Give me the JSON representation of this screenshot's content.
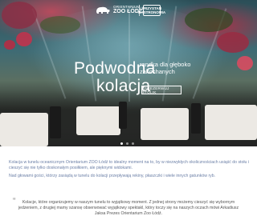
{
  "header": {
    "logo_zoo_line1": "ORIENTARIUM",
    "logo_zoo_line2": "ZOO ŁÓDŹ",
    "logo_badge_line1": "PRZYSTAN",
    "logo_badge_line2": "GASTRONOMIA"
  },
  "hero": {
    "title_part1": "Podwodna",
    "title_part2": "kolacja",
    "subtitle_line1": "randka dla głęboko",
    "subtitle_line2": "zakochanych",
    "reserve_button": "ZAREZERWUJ STOLIK",
    "slides": 3,
    "active_slide": 1
  },
  "description": {
    "para1": "Kolacja w tunelu oceanicznym Orientarium ZOO Łódź to idealny moment na to, by w niezwykłych okolicznościach usiąść do stołu i cieszyć się nie tylko doskonałym posiłkiem, ale pięknymi widokami.",
    "para2": "Nad głowami gości, którzy zasiądą w tunelu do kolacji przepływają rekiny, płaszczki i wiele innych gatunków ryb."
  },
  "quote": {
    "mark": "“",
    "text": "Kolacje, które organizujemy w naszym tunelu to wyjątkowy moment. Z jednej strony możemy cieszyć się wybornym jedzeniem, z drugiej mamy szansę obserwować wyjątkowy spektakl, który toczy się na naszych oczach mówi Arkadiusz Jaksa Prezes Orientarium Zoo Łódź."
  },
  "colors": {
    "body_text": "#6b7fa6",
    "quote_text": "#555555",
    "hero_text": "#ffffff"
  }
}
